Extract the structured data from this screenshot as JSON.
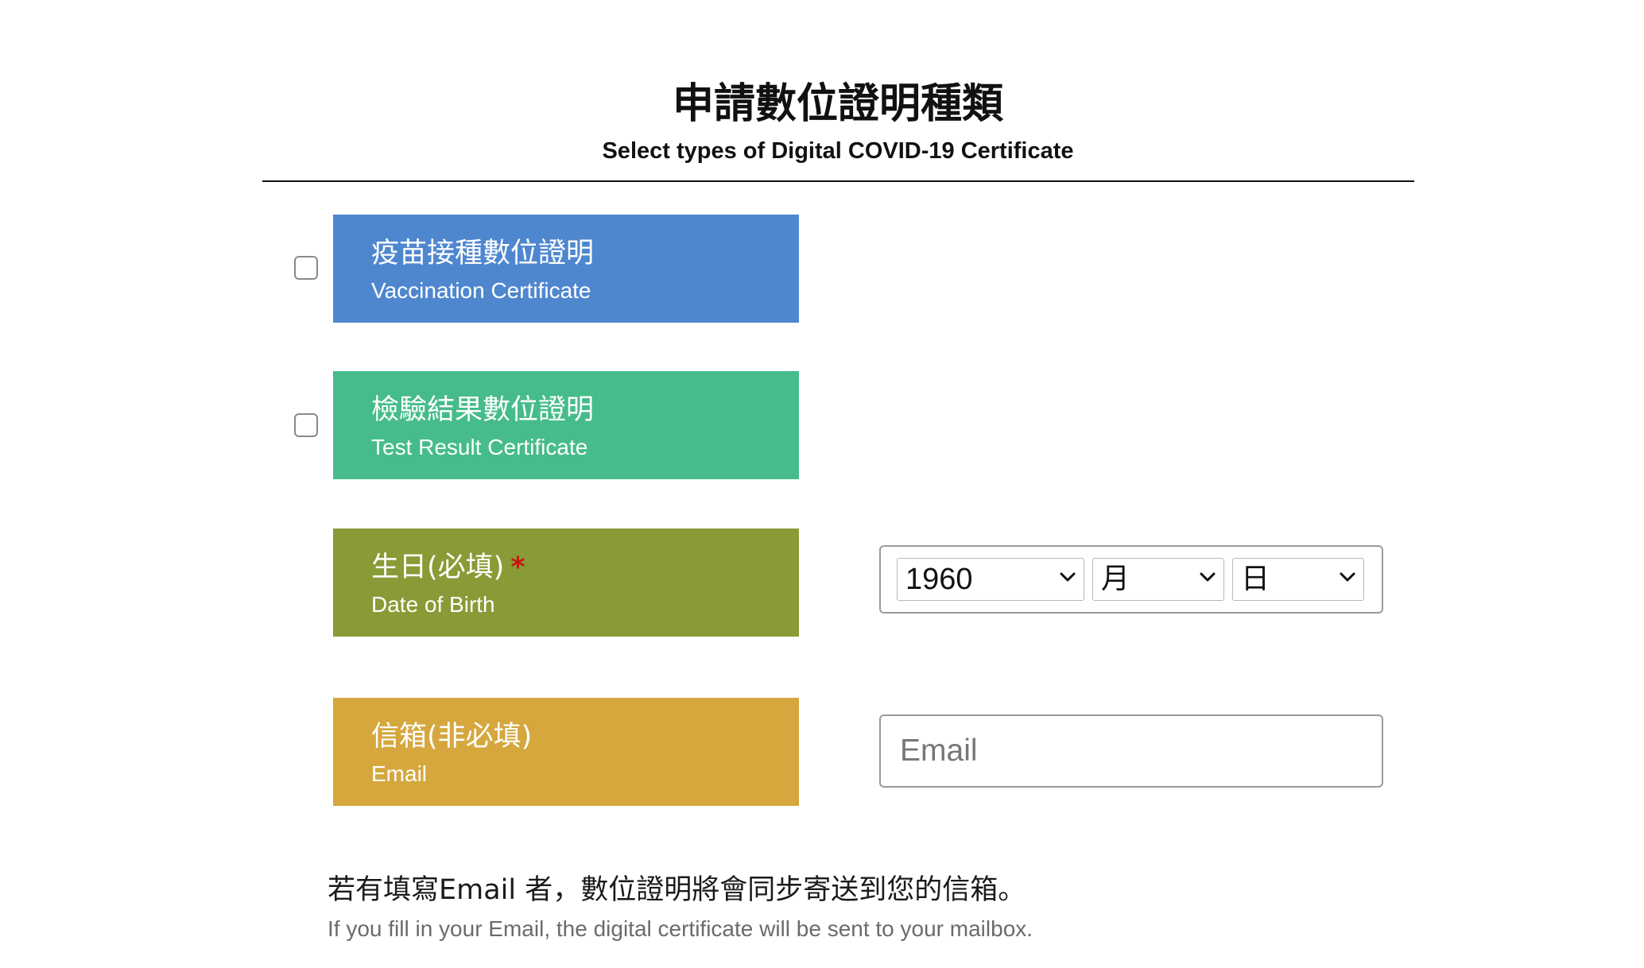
{
  "header": {
    "title": "申請數位證明種類",
    "subtitle": "Select types of Digital COVID-19 Certificate"
  },
  "certificates": [
    {
      "title_zh": "疫苗接種數位證明",
      "title_en": "Vaccination Certificate",
      "checked": false,
      "color": "#4f87cf"
    },
    {
      "title_zh": "檢驗結果數位證明",
      "title_en": "Test Result Certificate",
      "checked": false,
      "color": "#46bc8a"
    }
  ],
  "dob": {
    "label_zh": "生日(必填)",
    "required_mark": "*",
    "label_en": "Date of Birth",
    "color": "#889b36",
    "year_value": "1960",
    "month_value": "月",
    "day_value": "日"
  },
  "email": {
    "label_zh": "信箱(非必填)",
    "label_en": "Email",
    "color": "#d5a73d",
    "placeholder": "Email"
  },
  "note": {
    "zh": "若有填寫Email 者，數位證明將會同步寄送到您的信箱。",
    "en": "If you fill in your Email, the digital certificate will be sent to your mailbox."
  },
  "icons": {
    "select_arrow": "chevron-down-icon",
    "checkbox": "checkbox-unchecked"
  }
}
